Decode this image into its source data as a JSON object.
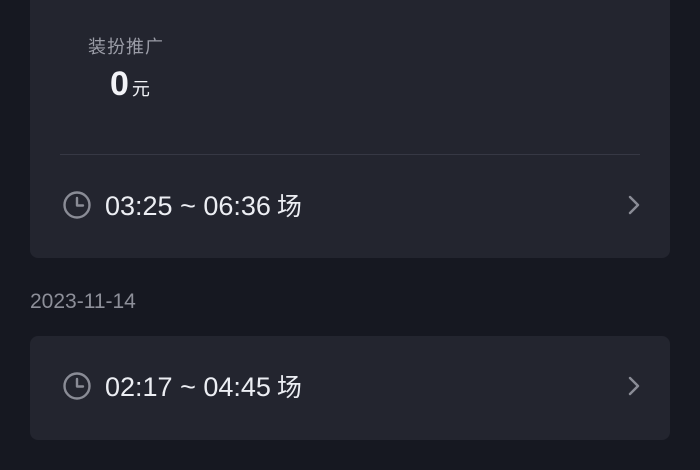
{
  "cards": [
    {
      "promo": {
        "label": "装扮推广",
        "amount": "0",
        "unit": "元"
      },
      "session": {
        "time_range": "03:25 ~ 06:36",
        "suffix": "场"
      }
    },
    {
      "session": {
        "time_range": "02:17 ~ 04:45",
        "suffix": "场"
      }
    }
  ],
  "date_group": {
    "date": "2023-11-14"
  },
  "icons": {
    "clock": "clock-icon",
    "chevron": "chevron-right-icon"
  },
  "colors": {
    "background": "#161821",
    "card": "#23252f",
    "text_primary": "#eceef3",
    "text_secondary": "#9a9ca6"
  }
}
